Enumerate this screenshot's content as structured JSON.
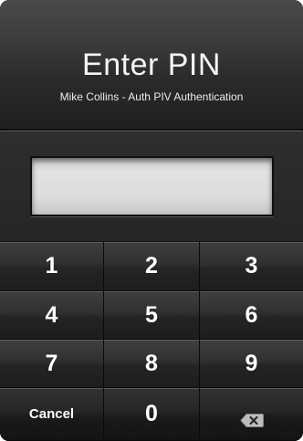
{
  "dialog": {
    "title": "Enter PIN",
    "subtitle": "Mike Collins - Auth PIV Authentication"
  },
  "pin_field": {
    "value": ""
  },
  "keypad": {
    "keys": [
      "1",
      "2",
      "3",
      "4",
      "5",
      "6",
      "7",
      "8",
      "9"
    ],
    "cancel_label": "Cancel",
    "zero_label": "0",
    "backspace_icon": "backspace-icon"
  },
  "colors": {
    "background": "#1c1c1c",
    "text": "#ffffff",
    "field": "#dcdcdc"
  }
}
